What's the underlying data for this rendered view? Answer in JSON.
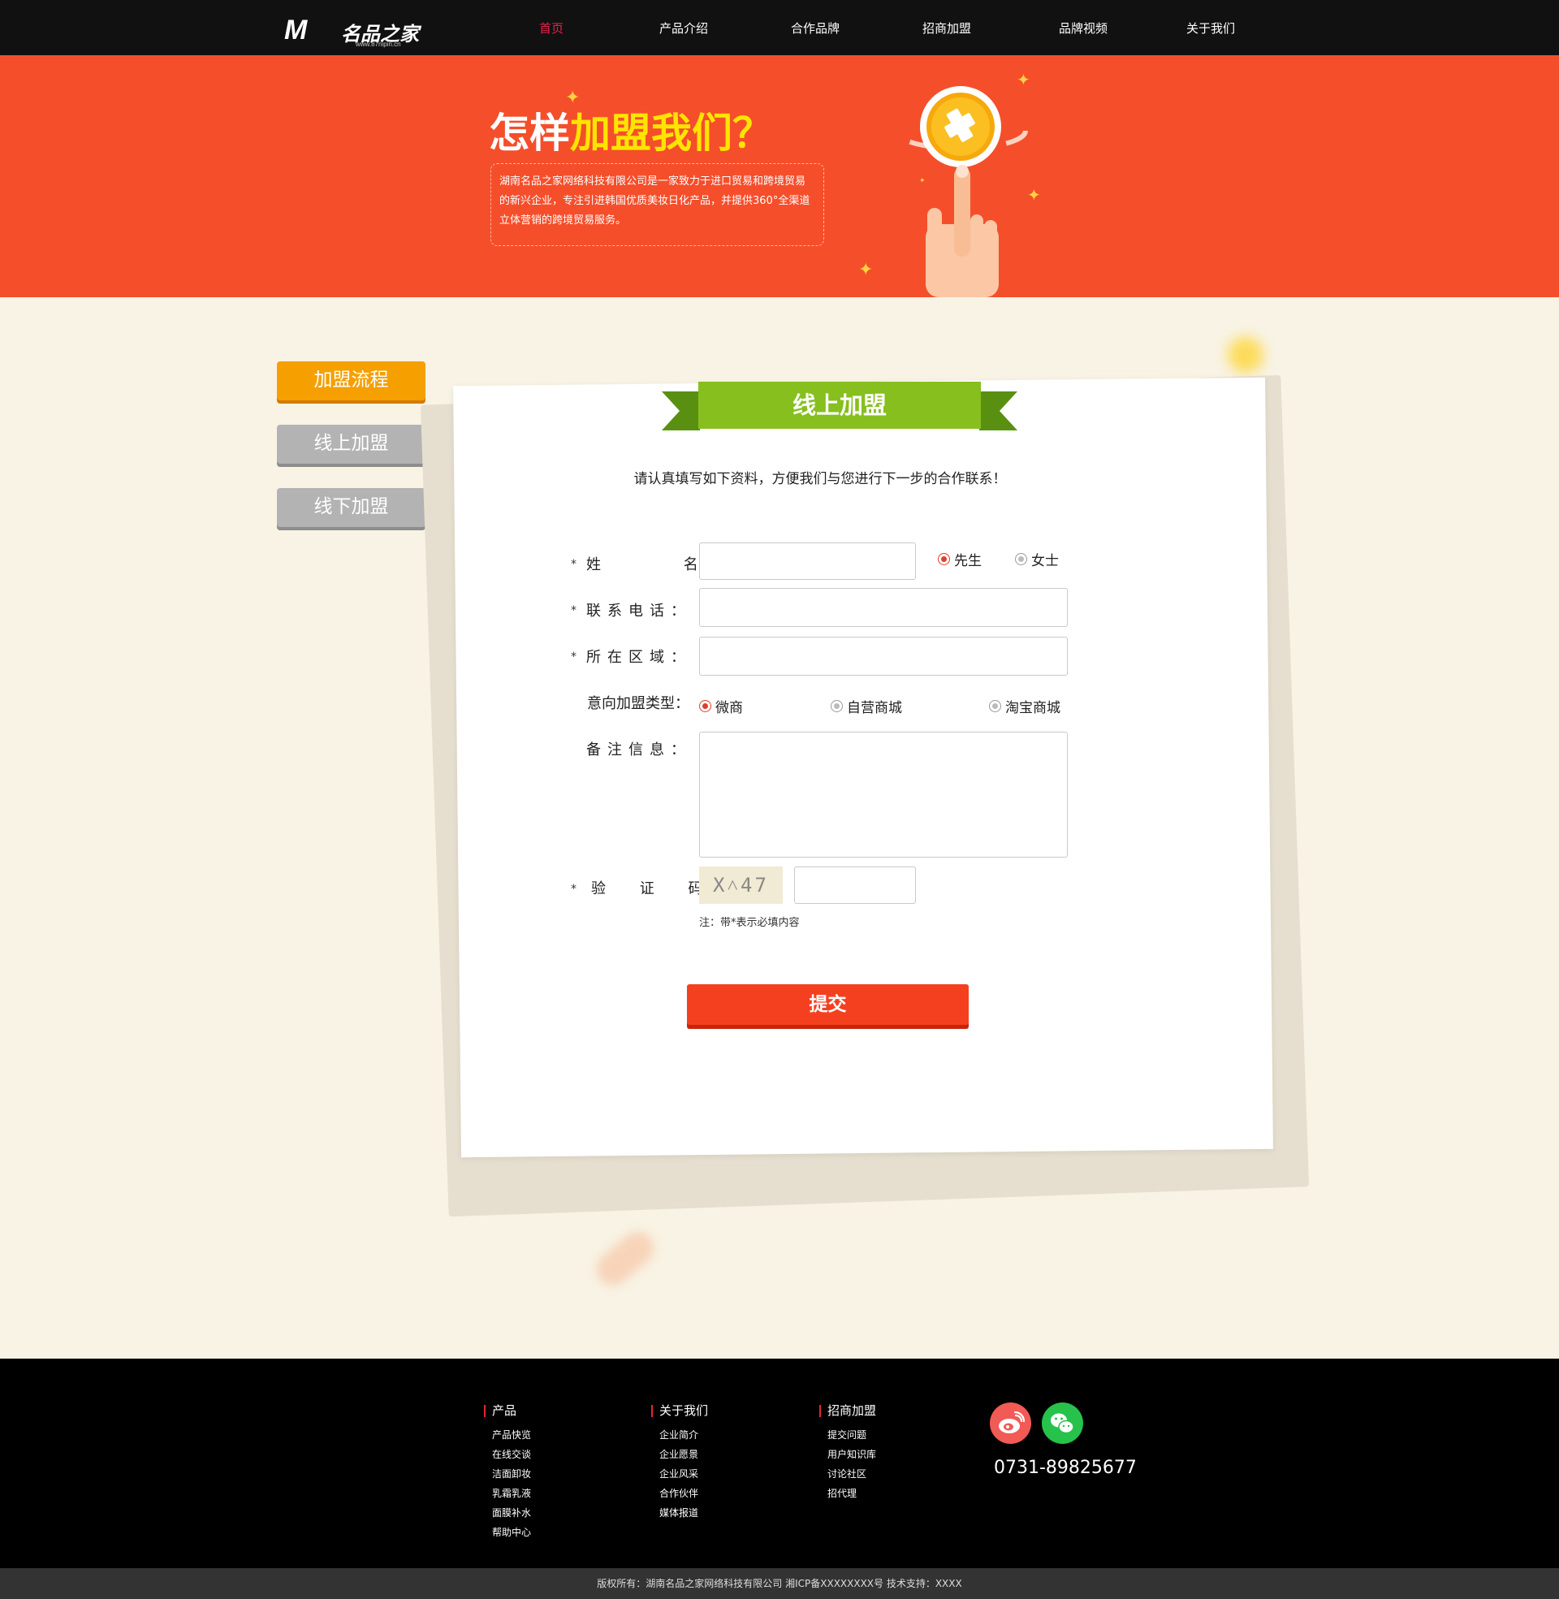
{
  "nav": {
    "logo_mark": "M",
    "logo_name": "名品之家",
    "logo_site": "www.87nipin.cn",
    "items": [
      "首页",
      "产品介绍",
      "合作品牌",
      "招商加盟",
      "品牌视频",
      "关于我们"
    ],
    "active_index": 0
  },
  "hero": {
    "title_prefix": "怎样",
    "title_highlight": "加盟我们？",
    "description": "湖南名品之家网络科技有限公司是一家致力于进口贸易和跨境贸易的新兴企业，专注引进韩国优质美妆日化产品，并提供360°全渠道立体营销的跨境贸易服务。"
  },
  "sidebar": {
    "items": [
      {
        "label": "加盟流程",
        "state": "active"
      },
      {
        "label": "线上加盟",
        "state": "inactive"
      },
      {
        "label": "线下加盟",
        "state": "inactive"
      }
    ]
  },
  "form": {
    "ribbon": "线上加盟",
    "intro": "请认真填写如下资料，方便我们与您进行下一步的合作联系！",
    "required_mark": "*",
    "name_label": "姓 名：",
    "name_value": "",
    "gender_options": [
      {
        "label": "先生",
        "checked": true
      },
      {
        "label": "女士",
        "checked": false
      }
    ],
    "phone_label": "联系电话：",
    "phone_value": "",
    "region_label": "所在区域：",
    "region_value": "",
    "type_label": "意向加盟类型：",
    "type_options": [
      {
        "label": "微商",
        "checked": true
      },
      {
        "label": "自营商城",
        "checked": false
      },
      {
        "label": "淘宝商城",
        "checked": false
      }
    ],
    "remark_label": "备注信息：",
    "remark_value": "",
    "captcha_label": "验 证 码：",
    "captcha_text": "X˄47",
    "captcha_value": "",
    "note": "注：带*表示必填内容",
    "submit": "提交"
  },
  "footer": {
    "columns": [
      {
        "title": "产品",
        "links": [
          "产品快览",
          "在线交谈",
          "洁面卸妆",
          "乳霜乳液",
          "面膜补水",
          "帮助中心"
        ]
      },
      {
        "title": "关于我们",
        "links": [
          "企业简介",
          "企业愿景",
          "企业风采",
          "合作伙伴",
          "媒体报道"
        ]
      },
      {
        "title": "招商加盟",
        "links": [
          "提交问题",
          "用户知识库",
          "讨论社区",
          "招代理"
        ]
      }
    ],
    "social": [
      {
        "name": "weibo-icon",
        "color": "#f15a55"
      },
      {
        "name": "wechat-icon",
        "color": "#26c24b"
      }
    ],
    "phone": "0731-89825677",
    "copyright": "版权所有：湖南名品之家网络科技有限公司   湘ICP备XXXXXXXX号   技术支持：XXXX"
  },
  "colors": {
    "nav_bg": "#111111",
    "hero_bg": "#f54e2b",
    "highlight": "#ffe400",
    "page_bg": "#f8f3e4",
    "ribbon": "#86bf1e",
    "submit": "#f5401f",
    "sidebar_active": "#f5a000",
    "sidebar_inactive": "#b3b3b3",
    "nav_active": "#e8204f"
  }
}
